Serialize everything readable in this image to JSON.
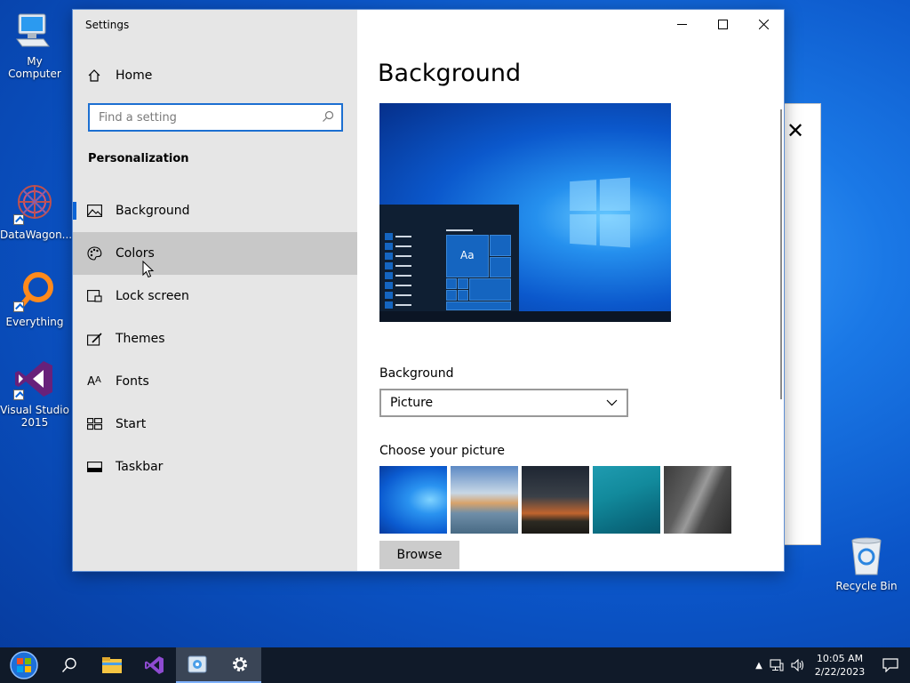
{
  "desktop": {
    "icons": [
      {
        "label": "My Computer"
      },
      {
        "label": "DataWagon..."
      },
      {
        "label": "Everything"
      },
      {
        "label": "Visual Studio 2015"
      },
      {
        "label": "Recycle Bin"
      }
    ]
  },
  "window": {
    "title": "Settings",
    "home_label": "Home",
    "search_placeholder": "Find a setting",
    "section_title": "Personalization",
    "nav_items": [
      {
        "label": "Background",
        "icon": "picture-icon"
      },
      {
        "label": "Colors",
        "icon": "palette-icon"
      },
      {
        "label": "Lock screen",
        "icon": "lock-screen-icon"
      },
      {
        "label": "Themes",
        "icon": "themes-icon"
      },
      {
        "label": "Fonts",
        "icon": "fonts-icon"
      },
      {
        "label": "Start",
        "icon": "start-icon"
      },
      {
        "label": "Taskbar",
        "icon": "taskbar-icon"
      }
    ],
    "selected_nav": "Background",
    "hovered_nav": "Colors",
    "page_title": "Background",
    "preview_tile_text": "Aa",
    "background_label": "Background",
    "background_value": "Picture",
    "choose_picture_label": "Choose your picture",
    "thumbnails": [
      "windows-blue-wallpaper",
      "beach-rock-arch",
      "night-sky-tent",
      "underwater-swimmer",
      "rock-cliff"
    ],
    "browse_label": "Browse"
  },
  "taskbar": {
    "items": [
      "start-button",
      "search-icon",
      "file-explorer-icon",
      "visual-studio-icon",
      "photos-icon",
      "settings-icon"
    ],
    "active_item": "settings-icon",
    "time": "10:05 AM",
    "date": "2/22/2023"
  },
  "colors": {
    "accent": "#0a64d6",
    "sidebar_bg": "#e6e6e6",
    "hover_bg": "#c8c8c8",
    "taskbar_bg": "#101a29"
  }
}
